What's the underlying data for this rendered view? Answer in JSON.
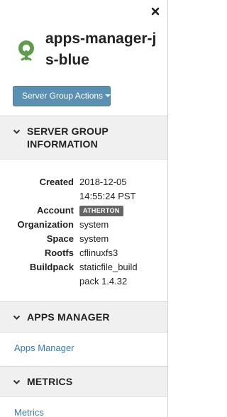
{
  "header": {
    "title": "apps-manager-js-blue",
    "actions_label": "Server Group Actions",
    "close_icon": "close-icon",
    "app_icon": "cloud-foundry-icon",
    "accent": "#5b91b0"
  },
  "server_group_info": {
    "title": "SERVER GROUP INFORMATION",
    "rows": [
      {
        "key": "Created",
        "value": "2018-12-05 14:55:24 PST"
      },
      {
        "key": "Account",
        "value": "ATHERTON"
      },
      {
        "key": "Organization",
        "value": "system"
      },
      {
        "key": "Space",
        "value": "system"
      },
      {
        "key": "Rootfs",
        "value": "cflinuxfs3"
      },
      {
        "key": "Buildpack",
        "value": "staticfile_build pack 1.4.32"
      }
    ]
  },
  "apps_manager": {
    "title": "APPS MANAGER",
    "link_label": "Apps Manager"
  },
  "metrics": {
    "title": "METRICS",
    "link_label": "Metrics"
  }
}
